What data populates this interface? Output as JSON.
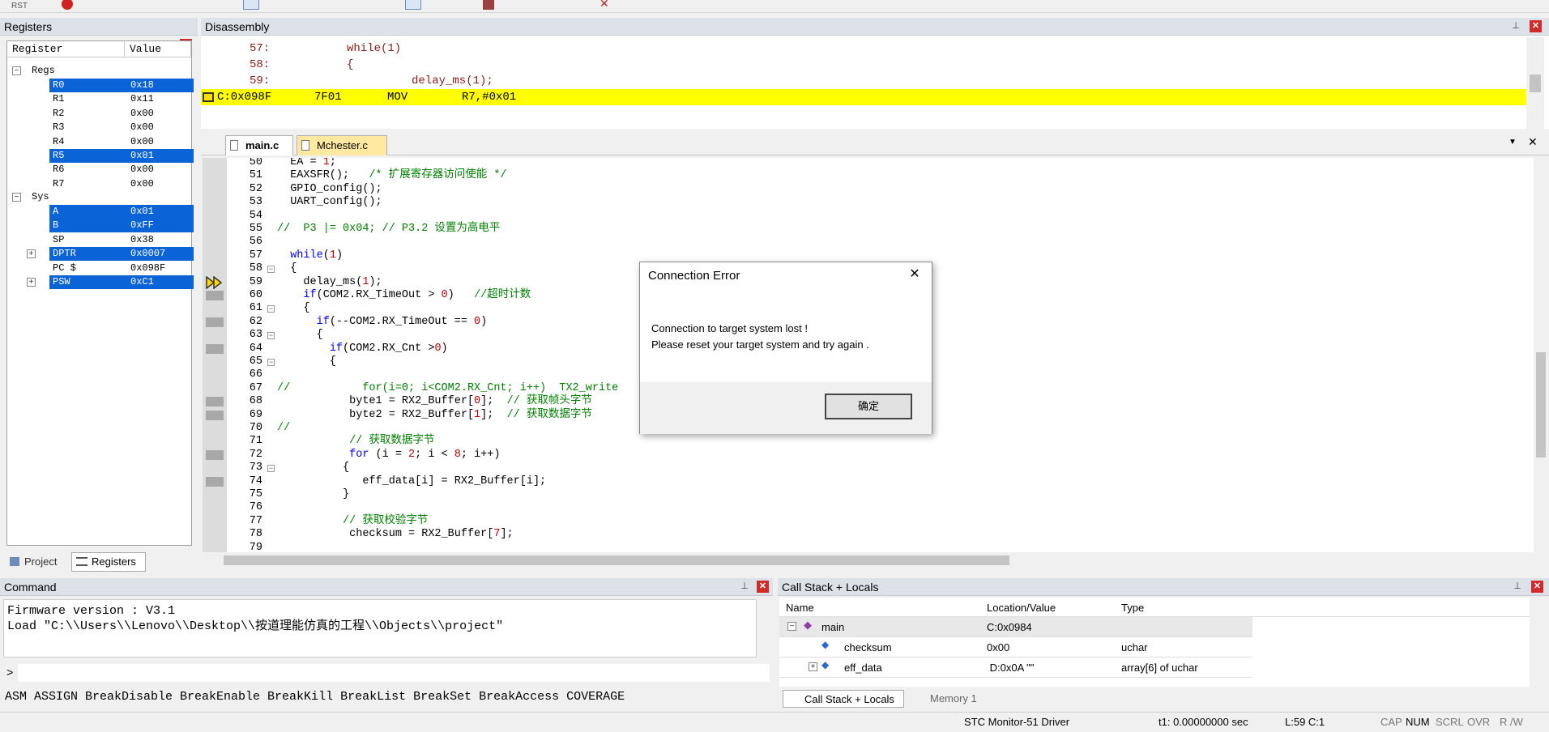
{
  "toolbar": {
    "rst_label": "RST"
  },
  "registers": {
    "title": "Registers",
    "col_register": "Register",
    "col_value": "Value",
    "group_regs": "Regs",
    "regs": [
      {
        "name": "R0",
        "value": "0x18",
        "selected": true
      },
      {
        "name": "R1",
        "value": "0x11",
        "selected": false
      },
      {
        "name": "R2",
        "value": "0x00",
        "selected": false
      },
      {
        "name": "R3",
        "value": "0x00",
        "selected": false
      },
      {
        "name": "R4",
        "value": "0x00",
        "selected": false
      },
      {
        "name": "R5",
        "value": "0x01",
        "selected": true
      },
      {
        "name": "R6",
        "value": "0x00",
        "selected": false
      },
      {
        "name": "R7",
        "value": "0x00",
        "selected": false
      }
    ],
    "group_sys": "Sys",
    "sys": [
      {
        "name": "A",
        "value": "0x01",
        "selected": true
      },
      {
        "name": "B",
        "value": "0xFF",
        "selected": true
      },
      {
        "name": "SP",
        "value": "0x38",
        "selected": false
      },
      {
        "name": "DPTR",
        "value": "0x0007",
        "selected": true
      },
      {
        "name": "PC  $",
        "value": "0x098F",
        "selected": false
      },
      {
        "name": "PSW",
        "value": "0xC1",
        "selected": true
      }
    ],
    "tab_project": "Project",
    "tab_registers": "Registers"
  },
  "disassembly": {
    "title": "Disassembly",
    "lines": [
      {
        "num": "57:",
        "code": "while(1)"
      },
      {
        "num": "58:",
        "code": "{"
      },
      {
        "num": "59:",
        "code": "delay_ms(1);"
      }
    ],
    "current": {
      "addr": "C:0x098F",
      "bytes": "7F01",
      "mnemonic": "MOV",
      "operands": "R7,#0x01"
    }
  },
  "editor": {
    "tabs": [
      "main.c",
      "Mchester.c"
    ],
    "lines": [
      {
        "n": "50",
        "t": "  EA = 1;"
      },
      {
        "n": "51",
        "t": "  EAXSFR();   /* 扩展寄存器访问使能 */"
      },
      {
        "n": "52",
        "t": "  GPIO_config();"
      },
      {
        "n": "53",
        "t": "  UART_config();"
      },
      {
        "n": "54",
        "t": ""
      },
      {
        "n": "55",
        "t": "//  P3 |= 0x04; // P3.2 设置为高电平"
      },
      {
        "n": "56",
        "t": ""
      },
      {
        "n": "57",
        "t": "  while(1)"
      },
      {
        "n": "58",
        "t": "  {"
      },
      {
        "n": "59",
        "t": "    delay_ms(1);"
      },
      {
        "n": "60",
        "t": "    if(COM2.RX_TimeOut > 0)   //超时计数"
      },
      {
        "n": "61",
        "t": "    {"
      },
      {
        "n": "62",
        "t": "      if(--COM2.RX_TimeOut == 0)"
      },
      {
        "n": "63",
        "t": "      {"
      },
      {
        "n": "64",
        "t": "        if(COM2.RX_Cnt >0)"
      },
      {
        "n": "65",
        "t": "        {"
      },
      {
        "n": "66",
        "t": ""
      },
      {
        "n": "67",
        "t": "//           for(i=0; i<COM2.RX_Cnt; i++)  TX2_write"
      },
      {
        "n": "68",
        "t": "           byte1 = RX2_Buffer[0];  // 获取帧头字节"
      },
      {
        "n": "69",
        "t": "           byte2 = RX2_Buffer[1];  // 获取数据字节"
      },
      {
        "n": "70",
        "t": "//"
      },
      {
        "n": "71",
        "t": "           // 获取数据字节"
      },
      {
        "n": "72",
        "t": "           for (i = 2; i < 8; i++)"
      },
      {
        "n": "73",
        "t": "          {"
      },
      {
        "n": "74",
        "t": "             eff_data[i] = RX2_Buffer[i];"
      },
      {
        "n": "75",
        "t": "          }"
      },
      {
        "n": "76",
        "t": ""
      },
      {
        "n": "77",
        "t": "          // 获取校验字节"
      },
      {
        "n": "78",
        "t": "           checksum = RX2_Buffer[7];"
      },
      {
        "n": "79",
        "t": ""
      }
    ]
  },
  "command": {
    "title": "Command",
    "lines": [
      "Firmware version : V3.1",
      "Load \"C:\\\\Users\\\\Lenovo\\\\Desktop\\\\按道理能仿真的工程\\\\Objects\\\\project\""
    ],
    "prompt": ">",
    "hint": "ASM ASSIGN BreakDisable BreakEnable BreakKill BreakList BreakSet BreakAccess COVERAGE"
  },
  "callstack": {
    "title": "Call Stack + Locals",
    "col_name": "Name",
    "col_loc": "Location/Value",
    "col_type": "Type",
    "rows": [
      {
        "name": "main",
        "loc": "C:0x0984",
        "type": ""
      },
      {
        "name": "checksum",
        "loc": "0x00",
        "type": "uchar"
      },
      {
        "name": "eff_data",
        "loc": " D:0x0A \"\"",
        "type": "array[6] of uchar"
      }
    ],
    "tab_callstack": "Call Stack + Locals",
    "tab_memory": "Memory 1"
  },
  "dialog": {
    "title": "Connection Error",
    "line1": "Connection to target system lost !",
    "line2": "Please reset your target system and try again .",
    "ok": "确定"
  },
  "status": {
    "driver": "STC Monitor-51 Driver",
    "time": "t1: 0.00000000 sec",
    "pos": "L:59 C:1",
    "caps": "CAP",
    "num": "NUM",
    "scrl": "SCRL",
    "ovr": "OVR",
    "rw": "R /W"
  }
}
